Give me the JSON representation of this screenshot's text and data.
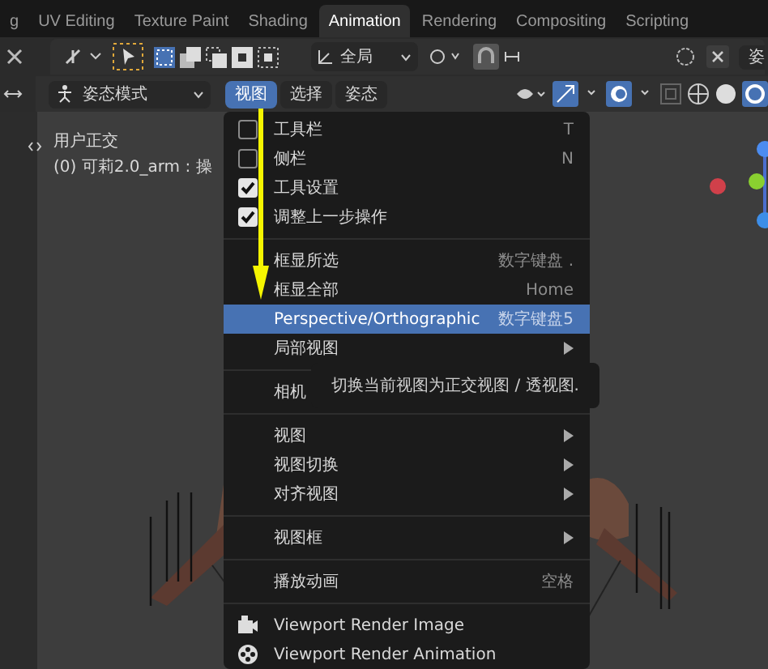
{
  "tabs": [
    {
      "label": "g",
      "selected": false
    },
    {
      "label": "UV Editing",
      "selected": false
    },
    {
      "label": "Texture Paint",
      "selected": false
    },
    {
      "label": "Shading",
      "selected": false
    },
    {
      "label": "Animation",
      "selected": true
    },
    {
      "label": "Rendering",
      "selected": false
    },
    {
      "label": "Compositing",
      "selected": false
    },
    {
      "label": "Scripting",
      "selected": false
    }
  ],
  "header": {
    "orientation": "全局",
    "right_cut_label": "姿",
    "mode": "姿态模式",
    "menus": [
      {
        "label": "视图",
        "selected": true
      },
      {
        "label": "选择",
        "selected": false
      },
      {
        "label": "姿态",
        "selected": false
      }
    ]
  },
  "viewport": {
    "view_name": "用户正交",
    "object_info": "(0) 可莉2.0_arm : 操"
  },
  "menu": {
    "items": [
      {
        "kind": "check",
        "label": "工具栏",
        "shortcut": "T",
        "checked": false,
        "selected": false
      },
      {
        "kind": "check",
        "label": "侧栏",
        "shortcut": "N",
        "checked": false,
        "selected": false
      },
      {
        "kind": "check",
        "label": "工具设置",
        "checked": true,
        "selected": false
      },
      {
        "kind": "check",
        "label": "调整上一步操作",
        "checked": true,
        "selected": false
      },
      {
        "kind": "separator"
      },
      {
        "kind": "action",
        "label": "框显所选",
        "shortcut": "数字键盘 .",
        "selected": false
      },
      {
        "kind": "action",
        "label": "框显全部",
        "shortcut": "Home",
        "selected": false
      },
      {
        "kind": "action",
        "label": "Perspective/Orthographic",
        "shortcut": "数字键盘5",
        "selected": true
      },
      {
        "kind": "submenu",
        "label": "局部视图",
        "selected": false
      },
      {
        "kind": "separator"
      },
      {
        "kind": "action",
        "label": "相机",
        "selected": false
      },
      {
        "kind": "separator"
      },
      {
        "kind": "submenu",
        "label": "视图",
        "selected": false
      },
      {
        "kind": "submenu",
        "label": "视图切换",
        "selected": false
      },
      {
        "kind": "submenu",
        "label": "对齐视图",
        "selected": false
      },
      {
        "kind": "separator"
      },
      {
        "kind": "submenu",
        "label": "视图框",
        "selected": false
      },
      {
        "kind": "separator"
      },
      {
        "kind": "action",
        "label": "播放动画",
        "shortcut": "空格",
        "selected": false
      },
      {
        "kind": "separator"
      },
      {
        "kind": "render_image",
        "label": "Viewport Render Image",
        "selected": false
      },
      {
        "kind": "render_animation",
        "label": "Viewport Render Animation",
        "selected": false
      }
    ]
  },
  "tooltip": {
    "text": "切换当前视图为正交视图 / 透视图."
  }
}
